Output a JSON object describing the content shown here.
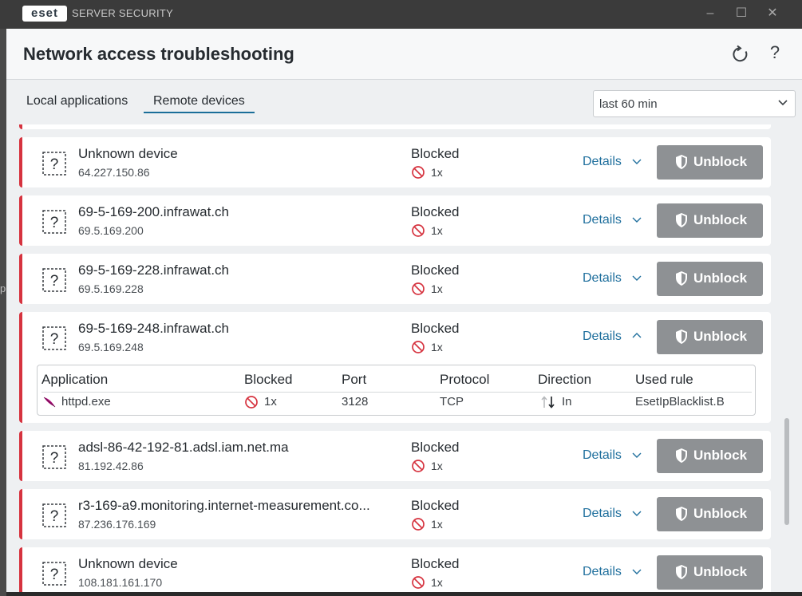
{
  "titlebar": {
    "logo_text": "eset",
    "app_name": "SERVER SECURITY",
    "minimize": "–",
    "maximize": "☐",
    "close": "✕"
  },
  "side_hint": "p",
  "header": {
    "title": "Network access troubleshooting",
    "help": "?"
  },
  "tabs": [
    {
      "label": "Local applications",
      "active": false
    },
    {
      "label": "Remote devices",
      "active": true
    }
  ],
  "time_filter": {
    "value": "last 60 min"
  },
  "colors": {
    "accent_blue": "#1f6f9d",
    "blocked_red": "#d6333f",
    "unblock_gray": "#8e9194"
  },
  "icons": {
    "device": "question-mark-dashed-box-icon",
    "blocked": "ban-icon",
    "unblock": "shield-icon",
    "refresh": "refresh-icon",
    "application": "feather-icon"
  },
  "devices": [
    {
      "name": "Unknown device",
      "ip": "64.227.150.86",
      "status": "Blocked",
      "count": "1x",
      "details": "Details",
      "unblock": "Unblock",
      "expanded": false
    },
    {
      "name": "69-5-169-200.infrawat.ch",
      "ip": "69.5.169.200",
      "status": "Blocked",
      "count": "1x",
      "details": "Details",
      "unblock": "Unblock",
      "expanded": false
    },
    {
      "name": "69-5-169-228.infrawat.ch",
      "ip": "69.5.169.228",
      "status": "Blocked",
      "count": "1x",
      "details": "Details",
      "unblock": "Unblock",
      "expanded": false
    },
    {
      "name": "69-5-169-248.infrawat.ch",
      "ip": "69.5.169.248",
      "status": "Blocked",
      "count": "1x",
      "details": "Details",
      "unblock": "Unblock",
      "expanded": true
    },
    {
      "name": "adsl-86-42-192-81.adsl.iam.net.ma",
      "ip": "81.192.42.86",
      "status": "Blocked",
      "count": "1x",
      "details": "Details",
      "unblock": "Unblock",
      "expanded": false
    },
    {
      "name": "r3-169-a9.monitoring.internet-measurement.co...",
      "ip": "87.236.176.169",
      "status": "Blocked",
      "count": "1x",
      "details": "Details",
      "unblock": "Unblock",
      "expanded": false
    },
    {
      "name": "Unknown device",
      "ip": "108.181.161.170",
      "status": "Blocked",
      "count": "1x",
      "details": "Details",
      "unblock": "Unblock",
      "expanded": false
    }
  ],
  "detail_table": {
    "headers": [
      "Application",
      "Blocked",
      "Port",
      "Protocol",
      "Direction",
      "Used rule"
    ],
    "row": {
      "application": "httpd.exe",
      "blocked": "1x",
      "port": "3128",
      "protocol": "TCP",
      "direction": "In",
      "used_rule": "EsetIpBlacklist.B"
    }
  }
}
